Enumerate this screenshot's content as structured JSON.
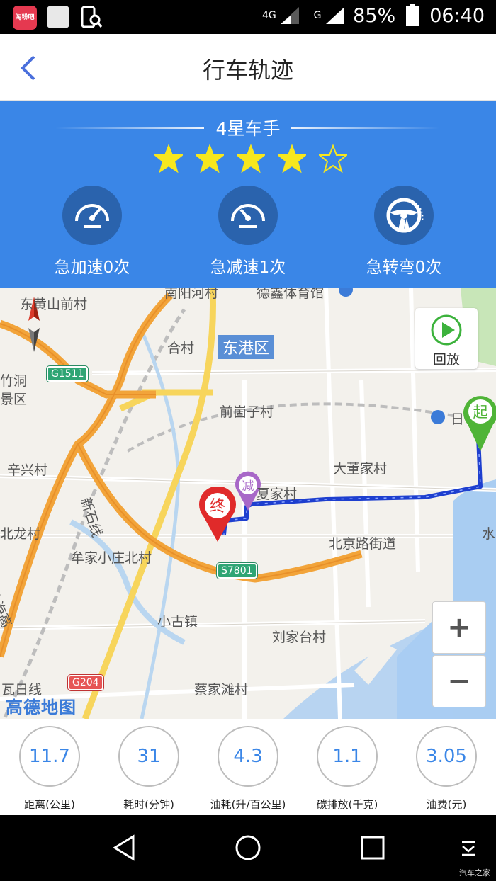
{
  "status_bar": {
    "app1_label": "淘粉吧",
    "network_4g": "4G",
    "network_g": "G",
    "battery": "85%",
    "time": "06:40"
  },
  "header": {
    "title": "行车轨迹",
    "back_icon": "chevron-left-icon"
  },
  "summary": {
    "rank": "4星车手",
    "rating": 4,
    "rating_max": 5,
    "metrics": [
      {
        "label": "急加速0次",
        "icon": "speedometer-icon"
      },
      {
        "label": "急减速1次",
        "icon": "speedometer-icon"
      },
      {
        "label": "急转弯0次",
        "icon": "steering-wheel-icon"
      }
    ],
    "colors": {
      "accent": "#3a86e7",
      "star": "#f7e71e",
      "icon_bg": "#2a63ad"
    }
  },
  "map": {
    "district": "东港区",
    "labels": [
      "东黄山前村",
      "合村",
      "前崮子村",
      "辛兴村",
      "大董家村",
      "夏家村",
      "北京路街道",
      "牟家小庄北村",
      "小古镇",
      "刘家台村",
      "蔡家滩村",
      "竹洞",
      "景区",
      "北龙村",
      "新石线",
      "沈海高",
      "瓦日线",
      "水",
      "德鑫体育馆",
      "南阳河村",
      "日"
    ],
    "road_shields": [
      "G1511",
      "S7801",
      "G204"
    ],
    "markers": {
      "start": "起",
      "end": "终",
      "decel": "减"
    },
    "replay_label": "回放",
    "zoom_in": "+",
    "zoom_out": "−",
    "attribution": "高德地图",
    "route_color": "#1e3fcf"
  },
  "stats": [
    {
      "value": "11.7",
      "label": "距离(公里)"
    },
    {
      "value": "31",
      "label": "耗时(分钟)"
    },
    {
      "value": "4.3",
      "label": "油耗(升/百公里)"
    },
    {
      "value": "1.1",
      "label": "碳排放(千克)"
    },
    {
      "value": "3.05",
      "label": "油费(元)"
    }
  ],
  "nav": {
    "back": "back-triangle-icon",
    "home": "home-circle-icon",
    "recents": "recents-square-icon",
    "menu": "menu-down-icon"
  },
  "watermark": "汽车之家"
}
